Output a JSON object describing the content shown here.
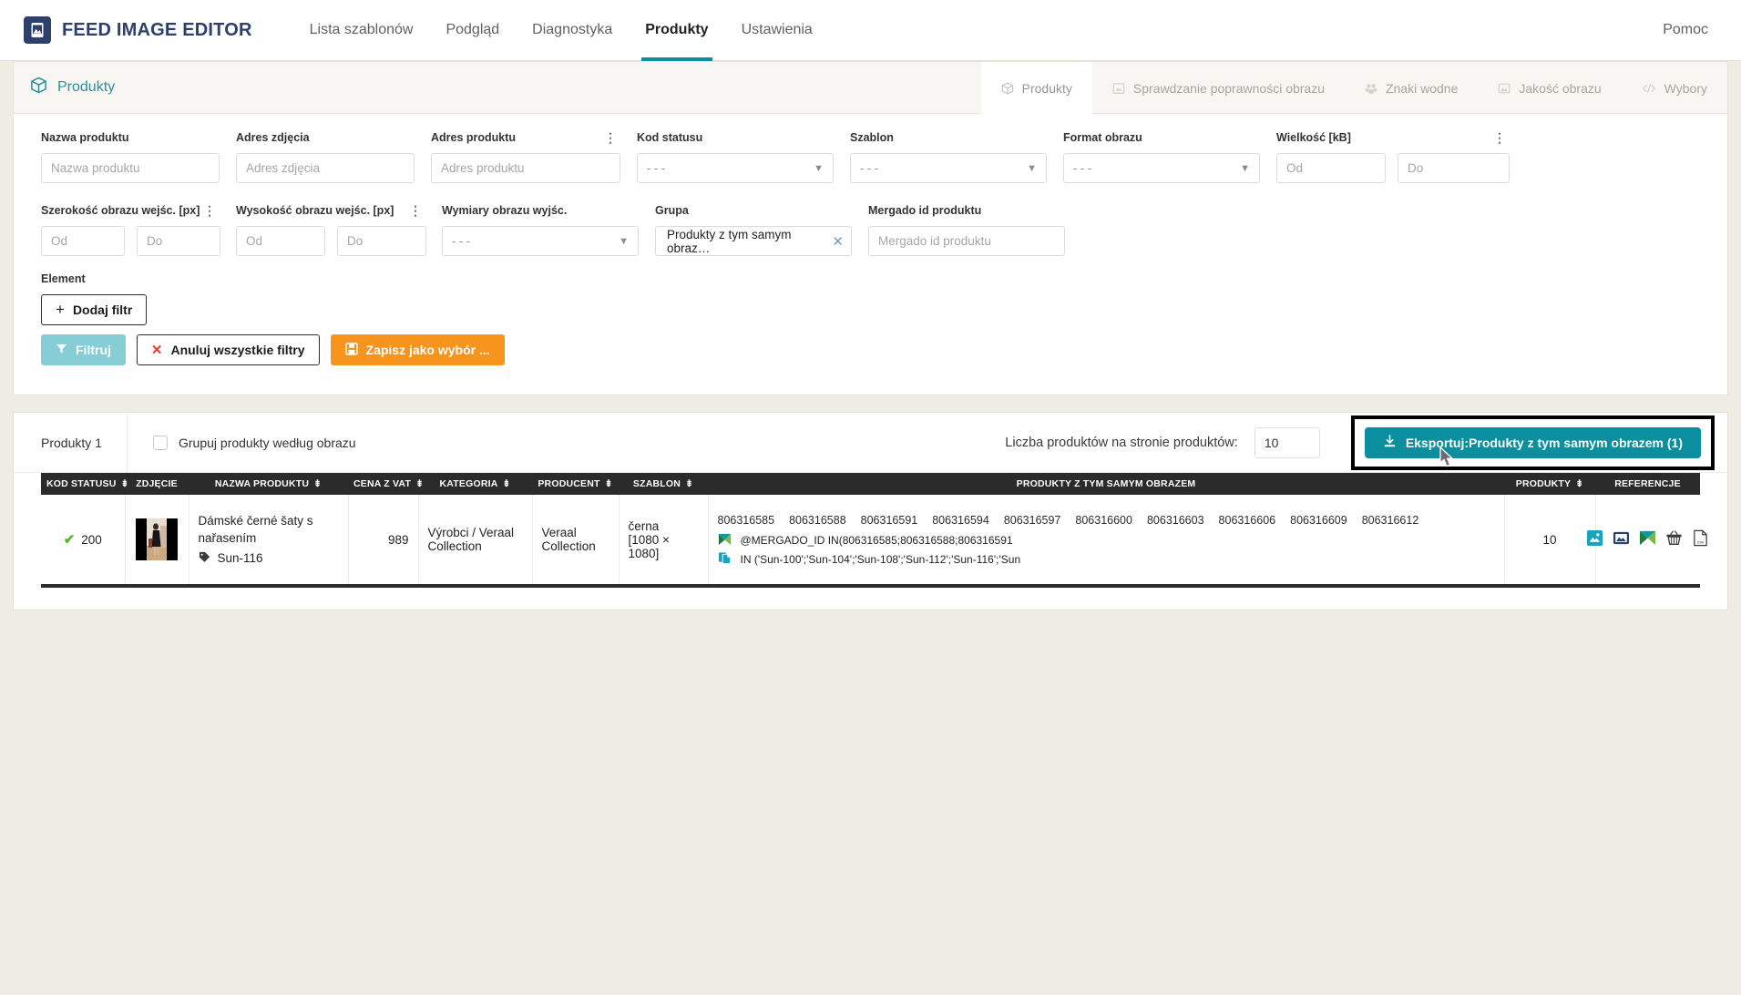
{
  "navbar": {
    "brand": "FEED IMAGE EDITOR",
    "logo_icon": "image-logo-icon",
    "tabs": [
      {
        "label": "Lista szablonów",
        "active": false
      },
      {
        "label": "Podgląd",
        "active": false
      },
      {
        "label": "Diagnostyka",
        "active": false
      },
      {
        "label": "Produkty",
        "active": true
      },
      {
        "label": "Ustawienia",
        "active": false
      }
    ],
    "help": "Pomoc"
  },
  "panel": {
    "title": "Produkty",
    "title_icon": "cube-icon",
    "tabs": [
      {
        "label": "Produkty",
        "icon": "cube-icon",
        "active": true
      },
      {
        "label": "Sprawdzanie poprawności obrazu",
        "icon": "image-check-icon",
        "active": false
      },
      {
        "label": "Znaki wodne",
        "icon": "watermark-icon",
        "active": false
      },
      {
        "label": "Jakość obrazu",
        "icon": "image-quality-icon",
        "active": false
      },
      {
        "label": "Wybory",
        "icon": "code-icon",
        "active": false
      }
    ]
  },
  "filters": {
    "row1": [
      {
        "label": "Nazwa produktu",
        "type": "text",
        "value": "",
        "placeholder": "Nazwa produktu",
        "kebab": false
      },
      {
        "label": "Adres zdjęcia",
        "type": "text",
        "value": "",
        "placeholder": "Adres zdjęcia",
        "kebab": false
      },
      {
        "label": "Adres produktu",
        "type": "text",
        "value": "",
        "placeholder": "Adres produktu",
        "kebab": true
      },
      {
        "label": "Kod statusu",
        "type": "select",
        "value": "- - -",
        "kebab": false
      },
      {
        "label": "Szablon",
        "type": "select",
        "value": "- - -",
        "kebab": false
      },
      {
        "label": "Format obrazu",
        "type": "select",
        "value": "- - -",
        "kebab": false
      },
      {
        "label": "Wielkość [kB]",
        "type": "range",
        "from_placeholder": "Od",
        "to_placeholder": "Do",
        "from": "",
        "to": "",
        "kebab": true
      }
    ],
    "row2": [
      {
        "label": "Szerokość obrazu wejśc. [px]",
        "type": "range",
        "from_placeholder": "Od",
        "to_placeholder": "Do",
        "from": "",
        "to": "",
        "kebab": true
      },
      {
        "label": "Wysokość obrazu wejśc. [px]",
        "type": "range",
        "from_placeholder": "Od",
        "to_placeholder": "Do",
        "from": "",
        "to": "",
        "kebab": true
      },
      {
        "label": "Wymiary obrazu wyjśc.",
        "type": "select",
        "value": "- - -",
        "kebab": false
      },
      {
        "label": "Grupa",
        "type": "tag",
        "value": "Produkty z tym samym obraz…",
        "kebab": false
      },
      {
        "label": "Mergado id produktu",
        "type": "text",
        "value": "",
        "placeholder": "Mergado id produktu",
        "kebab": false
      }
    ],
    "element_label": "Element",
    "add_filter": "Dodaj filtr",
    "buttons": {
      "filter": "Filtruj",
      "cancel_all": "Anuluj wszystkie filtry",
      "save_selection": "Zapisz jako wybór ..."
    }
  },
  "results": {
    "count_label": "Produkty 1",
    "group_checkbox_label": "Grupuj produkty według obrazu",
    "group_checked": false,
    "per_page_label": "Liczba produktów na stronie produktów:",
    "per_page_value": "10",
    "export_button": "Eksportuj:Produkty z tym samym obrazem (1)"
  },
  "table": {
    "columns": [
      {
        "label": "KOD STATUSU",
        "sortable": true
      },
      {
        "label": "ZDJĘCIE",
        "sortable": false
      },
      {
        "label": "NAZWA PRODUKTU",
        "sortable": true
      },
      {
        "label": "CENA Z VAT",
        "sortable": true
      },
      {
        "label": "KATEGORIA",
        "sortable": true
      },
      {
        "label": "PRODUCENT",
        "sortable": true
      },
      {
        "label": "SZABLON",
        "sortable": true
      },
      {
        "label": "PRODUKTY Z TYM SAMYM OBRAZEM",
        "sortable": false
      },
      {
        "label": "PRODUKTY",
        "sortable": true
      },
      {
        "label": "REFERENCJE",
        "sortable": false
      }
    ],
    "rows": [
      {
        "status_code": "200",
        "status_ok": true,
        "product_name": "Dámské černé šaty s nařasením",
        "sku": "Sun-116",
        "price": "989",
        "category": "Výrobci / Veraal Collection",
        "manufacturer": "Veraal Collection",
        "template": "černa",
        "template_dims": "[1080 × 1080]",
        "same_image_ids": [
          "806316585",
          "806316588",
          "806316591",
          "806316594",
          "806316597",
          "806316600",
          "806316603",
          "806316606",
          "806316609",
          "806316612"
        ],
        "rule_mergado": "@MERGADO_ID IN(806316585;806316588;806316591",
        "rule_sku": "IN ('Sun-100';'Sun-104';'Sun-108';'Sun-112';'Sun-116';'Sun",
        "products_count": "10",
        "references": [
          "image-file-icon",
          "image-frame-icon",
          "mergado-icon",
          "basket-icon",
          "csv-file-icon"
        ]
      }
    ]
  },
  "colors": {
    "brand": "#2d3f6b",
    "accent_teal": "#0b8f9e",
    "orange": "#f7941d",
    "status_green": "#52b832"
  }
}
